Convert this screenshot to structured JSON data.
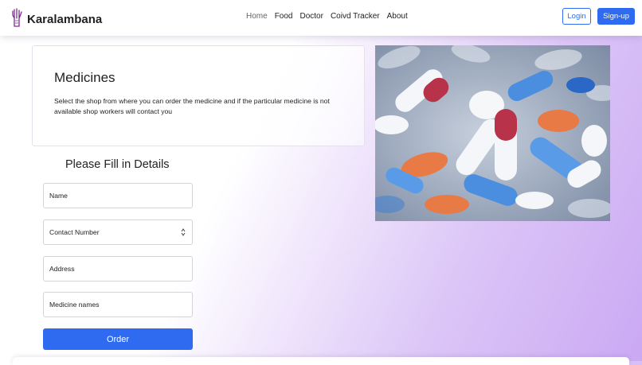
{
  "brand": {
    "name": "Karalambana",
    "icon": "hand-icon"
  },
  "nav": {
    "items": [
      {
        "label": "Home",
        "active": true
      },
      {
        "label": "Food",
        "active": false
      },
      {
        "label": "Doctor",
        "active": false
      },
      {
        "label": "Coivd Tracker",
        "active": false
      },
      {
        "label": "About",
        "active": false
      }
    ],
    "login_label": "Login",
    "signup_label": "Sign-up"
  },
  "card": {
    "title": "Medicines",
    "description": "Select the shop from where you can order the medicine and if the particular medicine is not available shop workers will contact you"
  },
  "image": {
    "subject": "pills-photo"
  },
  "form": {
    "title": "Please Fill in Details",
    "name_placeholder": "Name",
    "contact_placeholder": "Contact Number",
    "address_placeholder": "Address",
    "medicine_placeholder": "Medicine names",
    "order_label": "Order"
  },
  "colors": {
    "primary": "#2f6bf0",
    "accent": "#c7a6f2"
  }
}
